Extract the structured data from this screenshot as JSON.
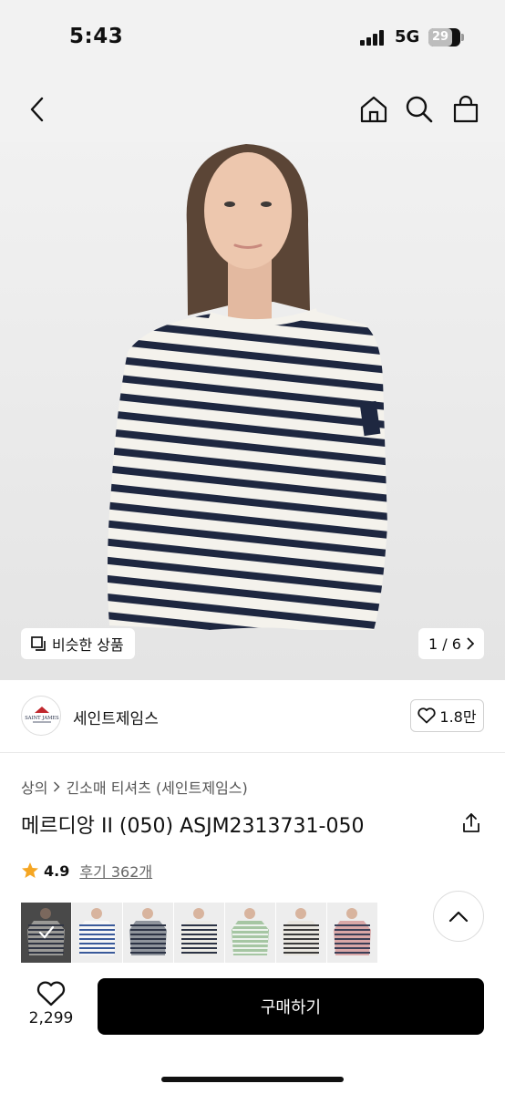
{
  "status": {
    "time": "5:43",
    "network": "5G",
    "battery": "29"
  },
  "nav": {
    "back_icon": "chevron-left-icon",
    "home_icon": "home-icon",
    "search_icon": "search-icon",
    "cart_icon": "shopping-bag-icon"
  },
  "hero": {
    "similar_label": "비슷한 상품",
    "page_indicator": "1 / 6"
  },
  "brand": {
    "logo_text": "SAINT JAMES",
    "name": "세인트제임스",
    "likes": "1.8만"
  },
  "product": {
    "breadcrumb": [
      "상의",
      "긴소매 티셔츠 (세인트제임스)"
    ],
    "title": "메르디앙 II (050) ASJM2313731-050",
    "rating": "4.9",
    "reviews": "후기 362개"
  },
  "thumbnails": [
    {
      "name": "navy-ecru",
      "body": "#e8e6e0",
      "stripe": "#27304a",
      "selected": true
    },
    {
      "name": "white-blue",
      "body": "#f6f6f6",
      "stripe": "#3a5a9a",
      "selected": false
    },
    {
      "name": "grey-navy",
      "body": "#8f949c",
      "stripe": "#2c3345",
      "selected": false
    },
    {
      "name": "ecru-navy",
      "body": "#ecebe6",
      "stripe": "#2c3345",
      "selected": false
    },
    {
      "name": "green-white",
      "body": "#a6c6a3",
      "stripe": "#eef3ee",
      "selected": false
    },
    {
      "name": "ecru-black",
      "body": "#e9e6df",
      "stripe": "#3a3a3a",
      "selected": false
    },
    {
      "name": "pink-navy",
      "body": "#d9a7a7",
      "stripe": "#3b3f57",
      "selected": false
    }
  ],
  "bottom": {
    "wish_count": "2,299",
    "buy_label": "구매하기"
  },
  "colors": {
    "stripe_navy": "#1e2740",
    "shirt_white": "#f4f2ec",
    "button_black": "#000000",
    "star": "#f5a623"
  }
}
